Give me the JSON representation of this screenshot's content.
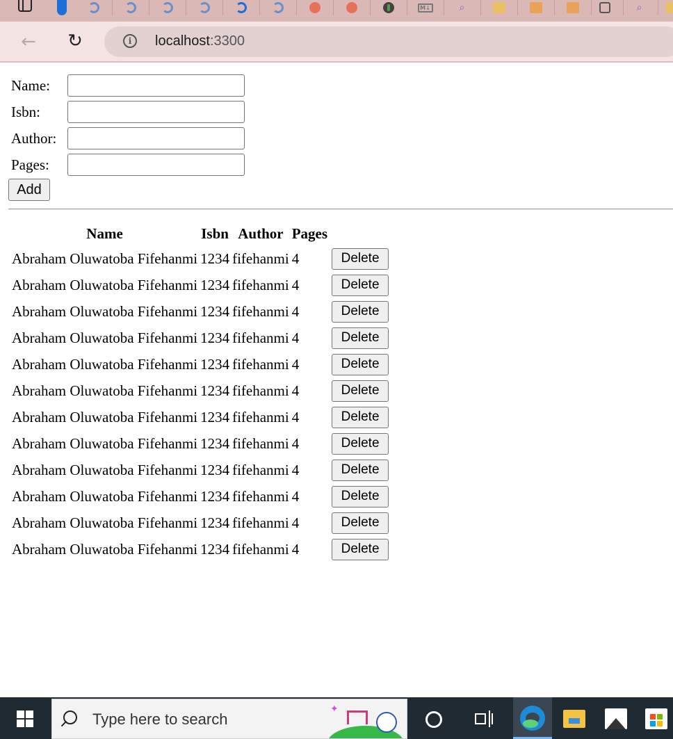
{
  "browser": {
    "url_host": "localhost",
    "url_port": ":3300",
    "tabs": [
      "sidebar-toggle-icon",
      "tab-pill-icon",
      "edge-tab-icon",
      "edge-tab-icon",
      "edge-tab-icon",
      "edge-tab-icon",
      "edge-tab-icon-active",
      "edge-tab-icon",
      "orange-app-icon",
      "orange-app-icon",
      "mongodb-icon",
      "markdown-icon",
      "search-tab-icon",
      "package-icon",
      "package-icon",
      "package-icon",
      "calendar-icon",
      "search-tab-icon",
      "package-icon"
    ]
  },
  "form": {
    "name_label": "Name:",
    "isbn_label": "Isbn:",
    "author_label": "Author:",
    "pages_label": "Pages:",
    "name_value": "",
    "isbn_value": "",
    "author_value": "",
    "pages_value": "",
    "add_label": "Add"
  },
  "table": {
    "headers": [
      "Name",
      "Isbn",
      "Author",
      "Pages"
    ],
    "delete_label": "Delete",
    "rows": [
      {
        "name": "Abraham Oluwatoba Fifehanmi",
        "isbn": "1234",
        "author": "fifehanmi",
        "pages": "4"
      },
      {
        "name": "Abraham Oluwatoba Fifehanmi",
        "isbn": "1234",
        "author": "fifehanmi",
        "pages": "4"
      },
      {
        "name": "Abraham Oluwatoba Fifehanmi",
        "isbn": "1234",
        "author": "fifehanmi",
        "pages": "4"
      },
      {
        "name": "Abraham Oluwatoba Fifehanmi",
        "isbn": "1234",
        "author": "fifehanmi",
        "pages": "4"
      },
      {
        "name": "Abraham Oluwatoba Fifehanmi",
        "isbn": "1234",
        "author": "fifehanmi",
        "pages": "4"
      },
      {
        "name": "Abraham Oluwatoba Fifehanmi",
        "isbn": "1234",
        "author": "fifehanmi",
        "pages": "4"
      },
      {
        "name": "Abraham Oluwatoba Fifehanmi",
        "isbn": "1234",
        "author": "fifehanmi",
        "pages": "4"
      },
      {
        "name": "Abraham Oluwatoba Fifehanmi",
        "isbn": "1234",
        "author": "fifehanmi",
        "pages": "4"
      },
      {
        "name": "Abraham Oluwatoba Fifehanmi",
        "isbn": "1234",
        "author": "fifehanmi",
        "pages": "4"
      },
      {
        "name": "Abraham Oluwatoba Fifehanmi",
        "isbn": "1234",
        "author": "fifehanmi",
        "pages": "4"
      },
      {
        "name": "Abraham Oluwatoba Fifehanmi",
        "isbn": "1234",
        "author": "fifehanmi",
        "pages": "4"
      },
      {
        "name": "Abraham Oluwatoba Fifehanmi",
        "isbn": "1234",
        "author": "fifehanmi",
        "pages": "4"
      }
    ]
  },
  "taskbar": {
    "search_placeholder": "Type here to search",
    "icons": [
      "windows-start-icon",
      "search-icon",
      "cortana-icon",
      "task-view-icon",
      "edge-browser-icon",
      "file-explorer-icon",
      "photos-icon",
      "microsoft-store-icon"
    ]
  },
  "colors": {
    "tabstrip": "#dab8b6",
    "toolbar": "#f3e4e3",
    "omnibox": "#e2d1d0",
    "taskbar": "#1f2a33",
    "accent": "#1b6fd6"
  }
}
